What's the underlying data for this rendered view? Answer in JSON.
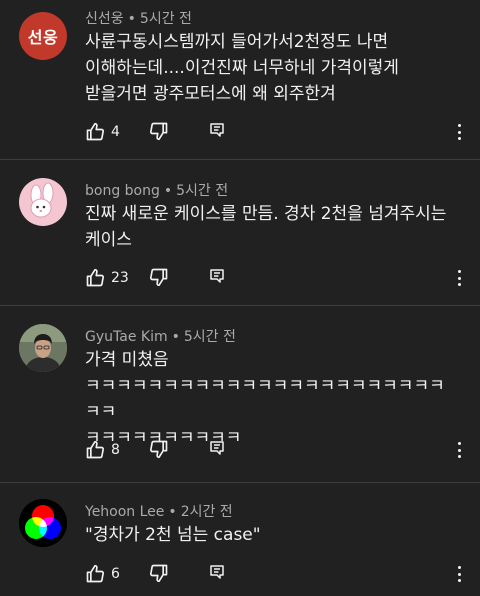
{
  "comments": [
    {
      "avatar_text": "선웅",
      "avatar_color": "#c0392b",
      "author": "신선웅",
      "time": "5시간 전",
      "text": "사륜구동시스템까지 들어가서2천정도 나면\n이해하는데....이건진짜 너무하네 가격이렇게\n받을거면 광주모터스에 왜 외주한겨",
      "likes": "4"
    },
    {
      "avatar_icon": "pink-bunny-avatar",
      "avatar_color": "#f3c6d2",
      "author": "bong bong",
      "time": "5시간 전",
      "text": "진짜 새로운 케이스를 만듬. 경차 2천을 넘겨주시는\n케이스",
      "likes": "23"
    },
    {
      "avatar_icon": "person-photo-avatar",
      "avatar_color": "#6b7763",
      "author": "GyuTae Kim",
      "time": "5시간 전",
      "text": "가격 미쳤음\nㅋㅋㅋㅋㅋㅋㅋㅋㅋㅋㅋㅋㅋㅋㅋㅋㅋㅋㅋㅋㅋㅋㅋㅋㅋ\nㅋㅋㅋㅋㅋㅋㅋㅋㅋㅋ",
      "likes": "8"
    },
    {
      "avatar_icon": "rgb-circles-avatar",
      "avatar_color": "#000000",
      "author": "Yehoon Lee",
      "time": "2시간 전",
      "text": "\"경차가 2천 넘는 case\"",
      "likes": "6"
    }
  ]
}
